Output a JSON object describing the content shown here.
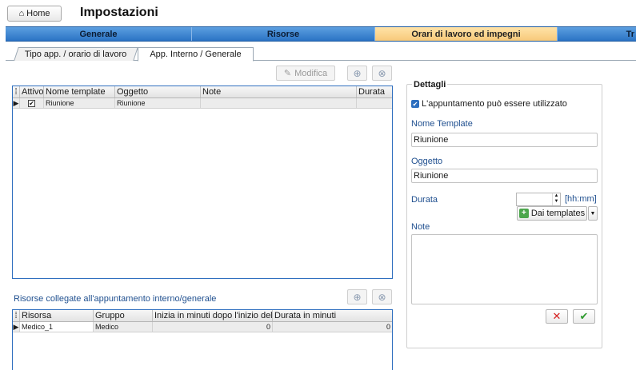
{
  "header": {
    "home_label": "Home",
    "title": "Impostazioni"
  },
  "main_tabs": [
    {
      "label": "Generale",
      "active": false
    },
    {
      "label": "Risorse",
      "active": false
    },
    {
      "label": "Orari di lavoro ed impegni",
      "active": true
    },
    {
      "label": "Tr",
      "active": false
    }
  ],
  "sub_tabs": [
    {
      "label": "Tipo app. / orario di lavoro",
      "active": false
    },
    {
      "label": "App. Interno / Generale",
      "active": true
    }
  ],
  "toolbar": {
    "edit_label": "Modifica"
  },
  "templates_grid": {
    "columns": [
      "Attivo",
      "Nome template",
      "Oggetto",
      "Note",
      "Durata"
    ],
    "rows": [
      {
        "attivo": true,
        "nome": "Riunione",
        "oggetto": "Riunione",
        "note": "",
        "durata": ""
      }
    ]
  },
  "resources_section": {
    "label": "Risorse collegate all'appuntamento interno/generale"
  },
  "resources_grid": {
    "columns": [
      "Risorsa",
      "Gruppo",
      "Inizia in minuti dopo l'inizio dell'a",
      "Durata in minuti"
    ],
    "rows": [
      {
        "risorsa": "Medico_1",
        "gruppo": "Medico",
        "inizio": "0",
        "durata": "0"
      }
    ]
  },
  "details": {
    "title": "Dettagli",
    "usable_label": "L'appuntamento può essere utilizzato",
    "usable_checked": true,
    "name_label": "Nome Template",
    "name_value": "Riunione",
    "subject_label": "Oggetto",
    "subject_value": "Riunione",
    "duration_label": "Durata",
    "duration_value": "",
    "duration_unit": "[hh:mm]",
    "templates_button": "Dai templates",
    "notes_label": "Note",
    "notes_value": ""
  },
  "colors": {
    "tab_blue": "#2b73c4",
    "tab_active": "#f7c97a",
    "label_blue": "#1f4f8f",
    "cancel_red": "#d62020",
    "ok_green": "#2e9a2e"
  }
}
